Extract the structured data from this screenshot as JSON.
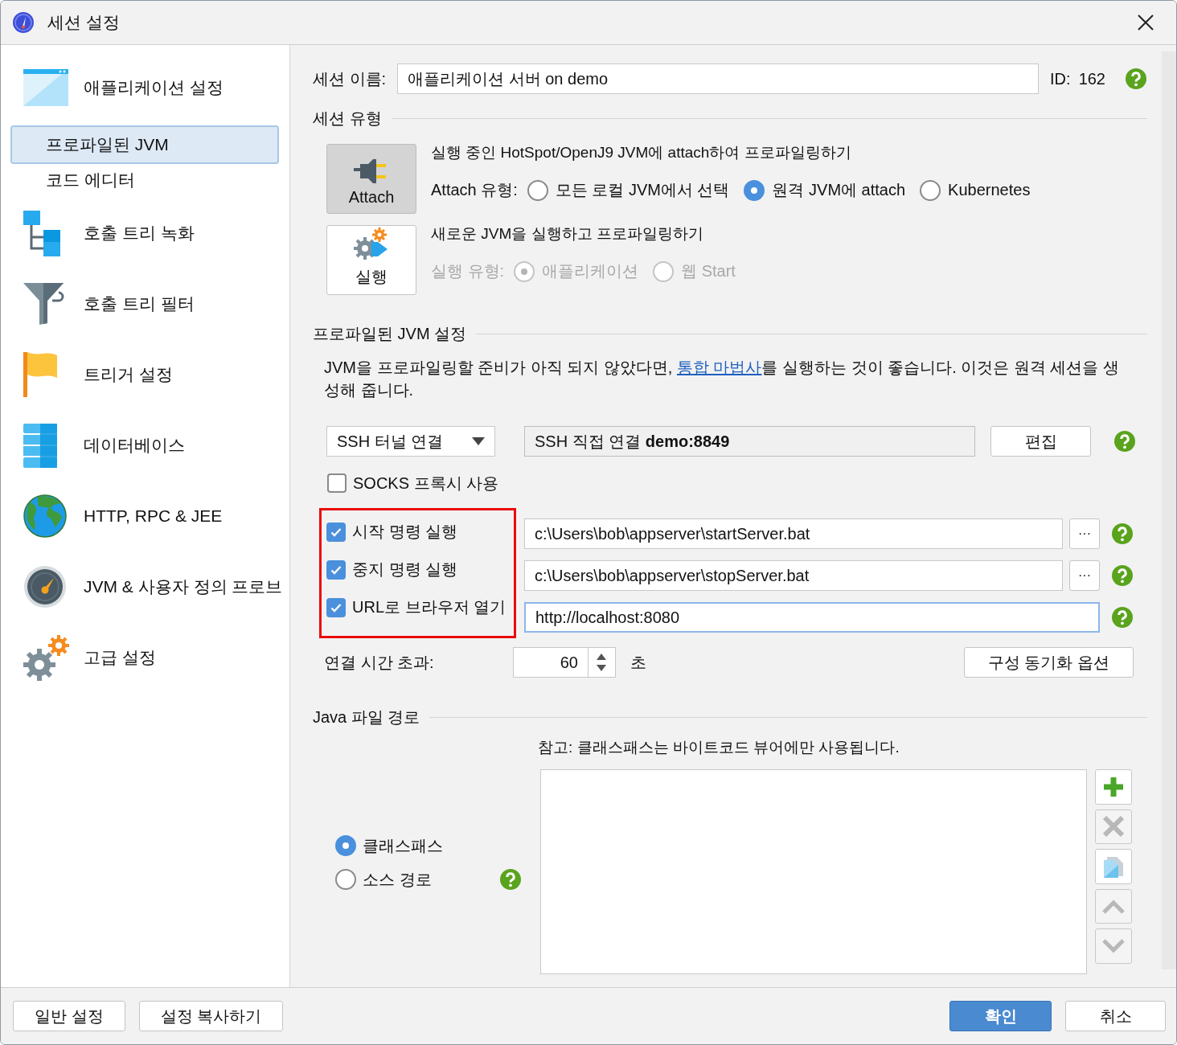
{
  "window": {
    "title": "세션 설정"
  },
  "sidebar": {
    "items": [
      {
        "label": "애플리케이션 설정",
        "selected": false,
        "children": [
          {
            "label": "프로파일된 JVM",
            "selected": true
          },
          {
            "label": "코드 에디터",
            "selected": false
          }
        ]
      },
      {
        "label": "호출 트리 녹화",
        "selected": false
      },
      {
        "label": "호출 트리 필터",
        "selected": false
      },
      {
        "label": "트리거 설정",
        "selected": false
      },
      {
        "label": "데이터베이스",
        "selected": false
      },
      {
        "label": "HTTP, RPC & JEE",
        "selected": false
      },
      {
        "label": "JVM & 사용자 정의 프로브",
        "selected": false
      },
      {
        "label": "고급 설정",
        "selected": false
      }
    ]
  },
  "session_name": {
    "label": "세션 이름:",
    "value": "애플리케이션 서버 on demo",
    "id_label": "ID:",
    "id_value": "162"
  },
  "session_type": {
    "heading": "세션 유형",
    "modes": [
      {
        "kind": "attach",
        "label": "Attach",
        "selected": true,
        "description": "실행 중인 HotSpot/OpenJ9 JVM에 attach하여 프로파일링하기",
        "type_label": "Attach 유형:",
        "disabled": false,
        "options": [
          {
            "label": "모든 로컬 JVM에서 선택",
            "selected": false
          },
          {
            "label": "원격 JVM에 attach",
            "selected": true
          },
          {
            "label": "Kubernetes",
            "selected": false
          }
        ]
      },
      {
        "kind": "launch",
        "label": "실행",
        "selected": false,
        "description": "새로운 JVM을 실행하고 프로파일링하기",
        "type_label": "실행 유형:",
        "disabled": true,
        "options": [
          {
            "label": "애플리케이션",
            "selected": true
          },
          {
            "label": "웹 Start",
            "selected": false
          }
        ]
      }
    ]
  },
  "profiled_jvm": {
    "heading": "프로파일된 JVM 설정",
    "note_before": "JVM을 프로파일링할 준비가 아직 되지 않았다면, ",
    "note_link": "통합 마법사",
    "note_after": "를 실행하는 것이 좋습니다. 이것은 원격 세션을 생성해 줍니다.",
    "connection_type": "SSH 터널 연결",
    "connection": "SSH 직접 연결 **demo:8849**",
    "edit_button": "편집",
    "socks": {
      "label": "SOCKS 프록시 사용",
      "checked": false
    },
    "commands_highlighted": true,
    "commands": [
      {
        "label": "시작 명령 실행",
        "checked": true,
        "value": "c:\\Users\\bob\\appserver\\startServer.bat",
        "browse_button": "···",
        "focused": false
      },
      {
        "label": "중지 명령 실행",
        "checked": true,
        "value": "c:\\Users\\bob\\appserver\\stopServer.bat",
        "browse_button": "···",
        "focused": false
      },
      {
        "label": "URL로 브라우저 열기",
        "checked": true,
        "value": "http://localhost:8080",
        "focused": true
      }
    ],
    "timeout": {
      "label": "연결 시간 초과:",
      "value": "60",
      "unit": "초"
    },
    "sync_button": "구성 동기화 옵션"
  },
  "java_path": {
    "heading": "Java 파일 경로",
    "options": [
      {
        "label": "클래스패스",
        "selected": true
      },
      {
        "label": "소스 경로",
        "selected": false
      }
    ],
    "note": "참고: 클래스패스는 바이트코드 뷰어에만 사용됩니다.",
    "tools": [
      {
        "kind": "add",
        "disabled": false
      },
      {
        "kind": "remove",
        "disabled": true
      },
      {
        "kind": "copy",
        "disabled": false
      },
      {
        "kind": "up",
        "disabled": true
      },
      {
        "kind": "down",
        "disabled": true
      }
    ]
  },
  "footer": {
    "left_buttons": [
      "일반 설정",
      "설정 복사하기"
    ],
    "ok": "확인",
    "cancel": "취소"
  }
}
